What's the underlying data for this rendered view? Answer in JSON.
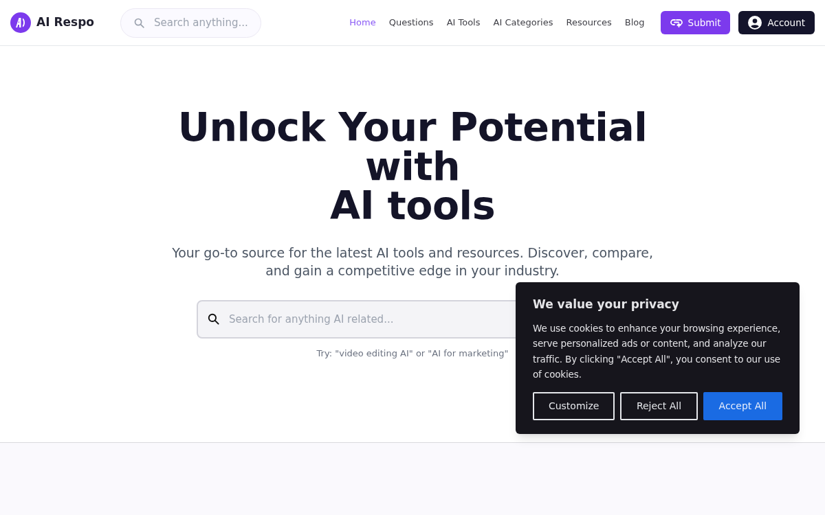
{
  "header": {
    "logo": {
      "text": "AI Respo"
    },
    "search": {
      "placeholder": "Search anything..."
    },
    "nav": [
      {
        "label": "Home",
        "selected": true
      },
      {
        "label": "Questions",
        "selected": false
      },
      {
        "label": "AI Tools",
        "selected": false
      },
      {
        "label": "AI Categories",
        "selected": false
      },
      {
        "label": "Resources",
        "selected": false
      },
      {
        "label": "Blog",
        "selected": false
      }
    ],
    "buttons": [
      {
        "kind": "submit",
        "label": "Submit"
      },
      {
        "kind": "account",
        "label": "Account"
      }
    ]
  },
  "hero": {
    "title_lines": [
      "Unlock Your Potential with",
      "AI tools"
    ],
    "subtitle": "Your go-to source for the latest AI tools and resources. Discover, compare, and gain a competitive edge in your industry.",
    "search": {
      "placeholder": "Search for anything AI related..."
    },
    "hint": "Try: \"video editing AI\" or \"AI for marketing\""
  },
  "cookie_banner": {
    "title": "We value your privacy",
    "text": "We use cookies to enhance your browsing experience, serve personalized ads or content, and analyze our traffic. By clicking \"Accept All\", you consent to our use of cookies.",
    "buttons": [
      {
        "kind": "outline",
        "label": "Customize"
      },
      {
        "kind": "outline",
        "label": "Reject All"
      },
      {
        "kind": "primary",
        "label": "Accept All"
      }
    ]
  }
}
